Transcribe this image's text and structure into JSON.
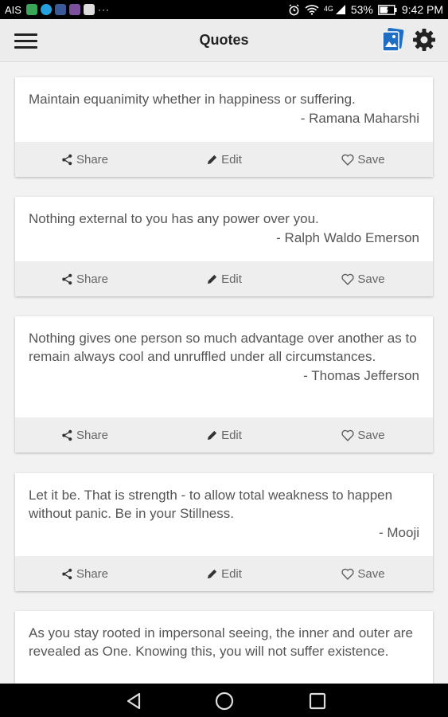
{
  "status_bar": {
    "carrier": "AIS",
    "notification_icons": [
      "line-icon",
      "message-icon",
      "facebook-icon",
      "viber-icon",
      "app-icon"
    ],
    "more": "···",
    "network": "4G",
    "battery": "53%",
    "time": "9:42 PM"
  },
  "header": {
    "title": "Quotes"
  },
  "actions": {
    "share": "Share",
    "edit": "Edit",
    "save": "Save"
  },
  "quotes": [
    {
      "text": "Maintain equanimity whether in happiness or suffering.",
      "author": "- Ramana Maharshi"
    },
    {
      "text": "Nothing external to you has any power over you.",
      "author": "- Ralph Waldo Emerson"
    },
    {
      "text": "Nothing gives one person so much advantage over another as to remain always cool and unruffled under all circumstances.",
      "author": "- Thomas Jefferson"
    },
    {
      "text": "Let it be. That is strength - to allow total weakness to happen without panic. Be in your Stillness.",
      "author": "- Mooji"
    },
    {
      "text": "As you stay rooted in impersonal seeing, the inner and outer are revealed as One. Knowing this, you will not suffer existence.",
      "author": ""
    }
  ],
  "colors": {
    "accent_blue": "#1e6fc4",
    "status_bar": "#000000",
    "app_bar": "#ececec"
  }
}
